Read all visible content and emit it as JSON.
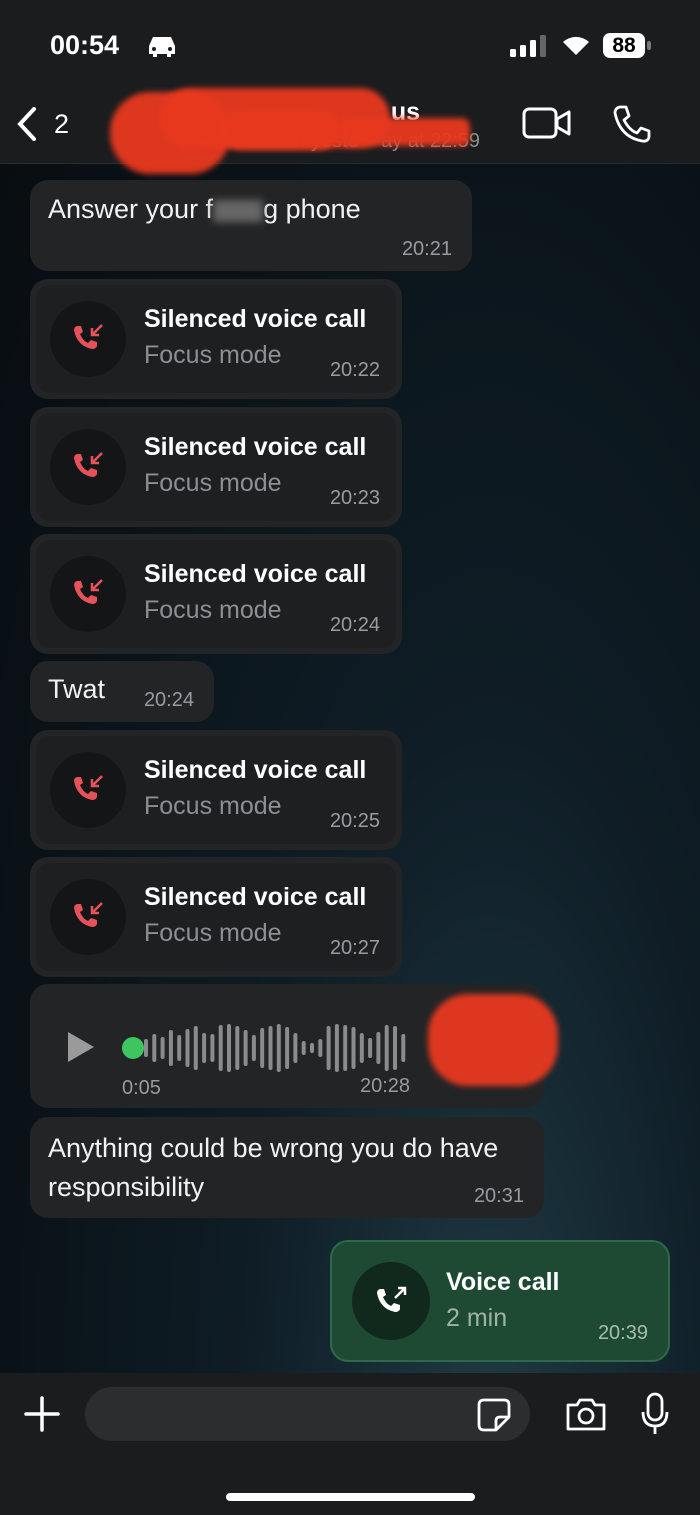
{
  "status_bar": {
    "time": "00:54",
    "battery": "88",
    "icons": [
      "car-icon",
      "signal-icon",
      "wifi-icon",
      "battery-icon"
    ]
  },
  "header": {
    "back_count": "2",
    "contact_name_visible": "us",
    "last_seen_visible": "n yeste    ay at 22:59",
    "icons": [
      "chevron-left-icon",
      "video-call-icon",
      "phone-icon"
    ]
  },
  "messages": [
    {
      "type": "text",
      "text_start": "Answer your f",
      "text_end": "g phone",
      "time": "20:21"
    },
    {
      "type": "call",
      "title": "Silenced voice call",
      "subtitle": "Focus mode",
      "time": "20:22"
    },
    {
      "type": "call",
      "title": "Silenced voice call",
      "subtitle": "Focus mode",
      "time": "20:23"
    },
    {
      "type": "call",
      "title": "Silenced voice call",
      "subtitle": "Focus mode",
      "time": "20:24"
    },
    {
      "type": "text",
      "text": "Twat",
      "time": "20:24"
    },
    {
      "type": "call",
      "title": "Silenced voice call",
      "subtitle": "Focus mode",
      "time": "20:25"
    },
    {
      "type": "call",
      "title": "Silenced voice call",
      "subtitle": "Focus mode",
      "time": "20:27"
    },
    {
      "type": "voice",
      "duration": "0:05",
      "time": "20:28",
      "played_fraction": 0
    },
    {
      "type": "text",
      "text": "Anything could be wrong you do have responsibility",
      "time": "20:31"
    },
    {
      "type": "outgoing_call",
      "title": "Voice call",
      "subtitle": "2 min",
      "time": "20:39"
    }
  ],
  "colors": {
    "outgoing_bubble": "#1e4a33",
    "missed_call": "#e5525a",
    "voice_dot": "#3ec55f"
  },
  "composer": {
    "icons": [
      "plus-icon",
      "sticker-icon",
      "camera-icon",
      "microphone-icon"
    ],
    "value": ""
  }
}
